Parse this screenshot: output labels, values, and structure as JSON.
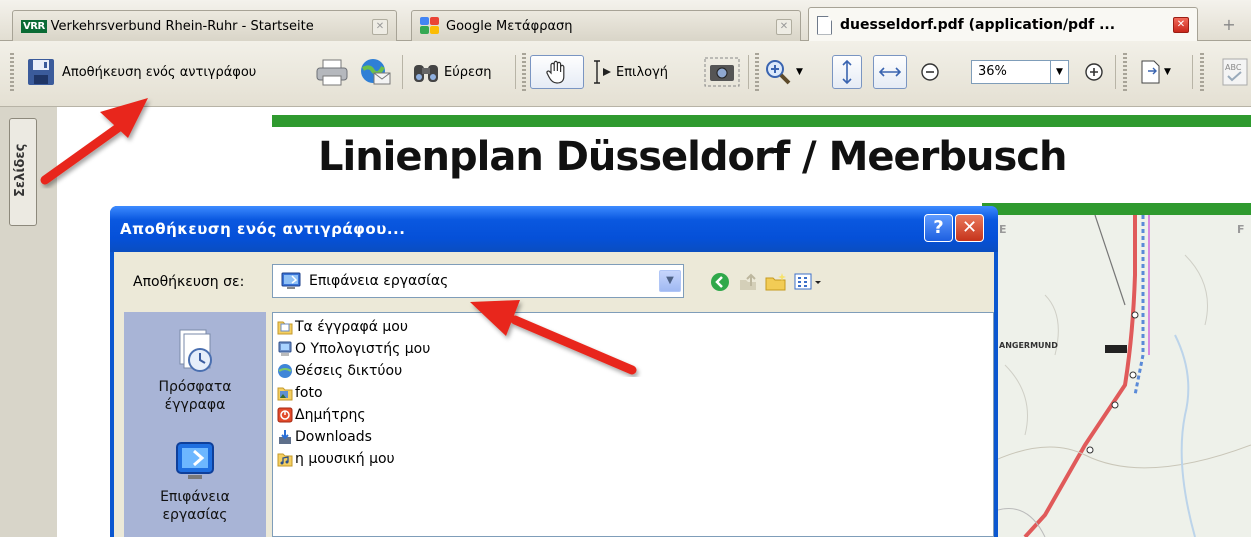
{
  "tabs": [
    {
      "favicon": "vrr-logo",
      "favicon_text": "VRR",
      "label": "Verkehrsverbund Rhein-Ruhr - Startseite"
    },
    {
      "favicon": "google-translate-icon",
      "label": "Google Μετάφραση"
    },
    {
      "favicon": "pdf-document-icon",
      "label": "duesseldorf.pdf (application/pdf ...",
      "active": true
    }
  ],
  "new_tab_symbol": "+",
  "toolbar": {
    "save_copy_label": "Αποθήκευση ενός αντιγράφου",
    "find_label": "Εύρεση",
    "select_label": "Επιλογή",
    "zoom_value": "36%"
  },
  "side_panel": {
    "pages_tab_label": "Σελίδες"
  },
  "document": {
    "title": "Linienplan Düsseldorf / Meerbusch",
    "map_labels": [
      "ANGERMUND",
      "E",
      "F"
    ]
  },
  "dialog": {
    "title": "Αποθήκευση ενός αντιγράφου...",
    "help_symbol": "?",
    "close_symbol": "✕",
    "save_in_label": "Αποθήκευση σε:",
    "save_in_value": "Επιφάνεια εργασίας",
    "places": [
      {
        "icon": "recent-documents-icon",
        "label": "Πρόσφατα έγγραφα"
      },
      {
        "icon": "desktop-icon",
        "label": "Επιφάνεια εργασίας"
      }
    ],
    "files": [
      {
        "icon": "my-documents-icon",
        "name": "Τα έγγραφά μου"
      },
      {
        "icon": "my-computer-icon",
        "name": "Ο Υπολογιστής μου"
      },
      {
        "icon": "network-places-icon",
        "name": "Θέσεις δικτύου"
      },
      {
        "icon": "photo-folder-icon",
        "name": "foto"
      },
      {
        "icon": "user-folder-icon",
        "name": "Δημήτρης"
      },
      {
        "icon": "downloads-folder-icon",
        "name": "Downloads"
      },
      {
        "icon": "music-folder-icon",
        "name": "η μουσική μου"
      }
    ]
  },
  "colors": {
    "accent_green": "#2f9a2f",
    "dialog_blue": "#0b57d0",
    "arrow_red": "#e8261a"
  }
}
